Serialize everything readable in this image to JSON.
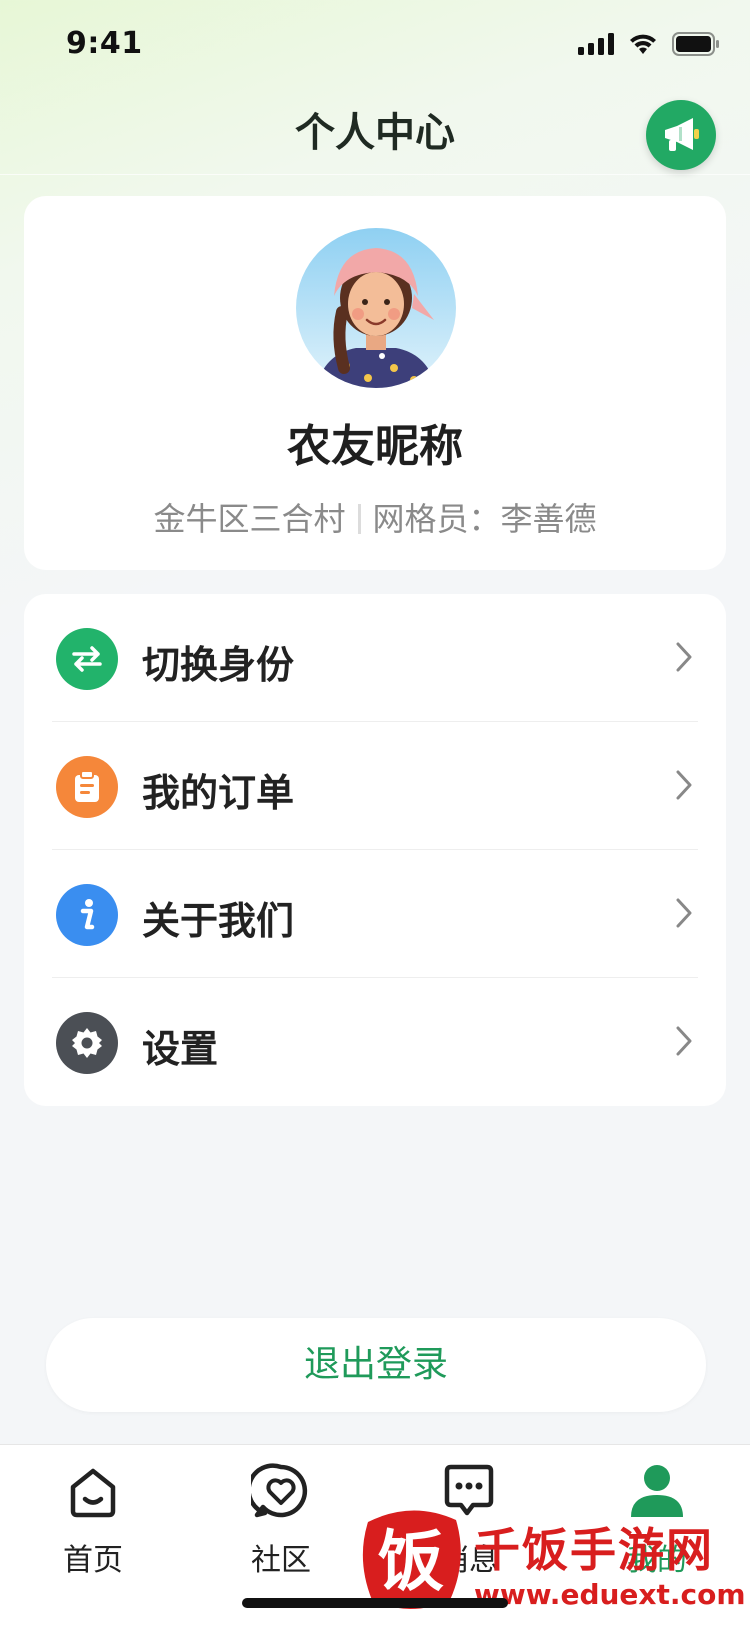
{
  "status_bar": {
    "time": "9:41"
  },
  "header": {
    "title": "个人中心",
    "announce_icon": "megaphone-icon"
  },
  "profile": {
    "nickname": "农友昵称",
    "location": "金牛区三合村",
    "grid_officer": "网格员：李善德"
  },
  "menu": [
    {
      "label": "切换身份",
      "icon": "switch-arrows-icon",
      "color": "#22b36b"
    },
    {
      "label": "我的订单",
      "icon": "clipboard-icon",
      "color": "#f5873a"
    },
    {
      "label": "关于我们",
      "icon": "info-icon",
      "color": "#3a8ef0"
    },
    {
      "label": "设置",
      "icon": "gear-icon",
      "color": "#4b4f55"
    }
  ],
  "logout": {
    "label": "退出登录"
  },
  "tab_bar": {
    "tabs": [
      {
        "label": "首页",
        "icon": "home-icon"
      },
      {
        "label": "社区",
        "icon": "heart-chat-icon"
      },
      {
        "label": "消息",
        "icon": "message-dots-icon"
      },
      {
        "label": "我的",
        "icon": "user-icon"
      }
    ],
    "active": "我的"
  },
  "colors": {
    "accent": "#1f9a5a",
    "accent_bright": "#22a964"
  },
  "watermark": {
    "title": "千饭手游网",
    "url": "www.eduext.com",
    "seal": "饭"
  }
}
